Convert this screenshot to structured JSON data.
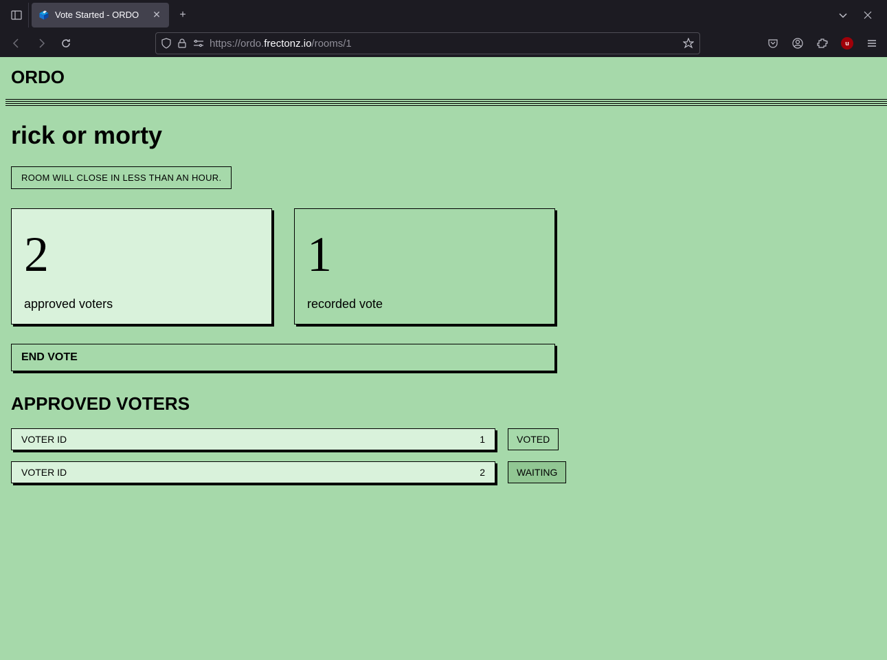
{
  "browser": {
    "tab_title": "Vote Started - ORDO",
    "url_prefix": "https://ordo.",
    "url_domain": "frectonz.io",
    "url_suffix": "/rooms/1"
  },
  "header": {
    "logo": "ORDO"
  },
  "room": {
    "title": "rick or morty",
    "status_message": "ROOM WILL CLOSE IN LESS THAN AN HOUR."
  },
  "stats": [
    {
      "value": "2",
      "label": "approved voters"
    },
    {
      "value": "1",
      "label": "recorded vote"
    }
  ],
  "actions": {
    "end_vote": "END VOTE"
  },
  "voters_section": {
    "title": "APPROVED VOTERS",
    "id_label": "VOTER ID",
    "status_voted": "VOTED",
    "status_waiting": "WAITING",
    "list": [
      {
        "id": "1",
        "status": "voted"
      },
      {
        "id": "2",
        "status": "waiting"
      }
    ]
  }
}
